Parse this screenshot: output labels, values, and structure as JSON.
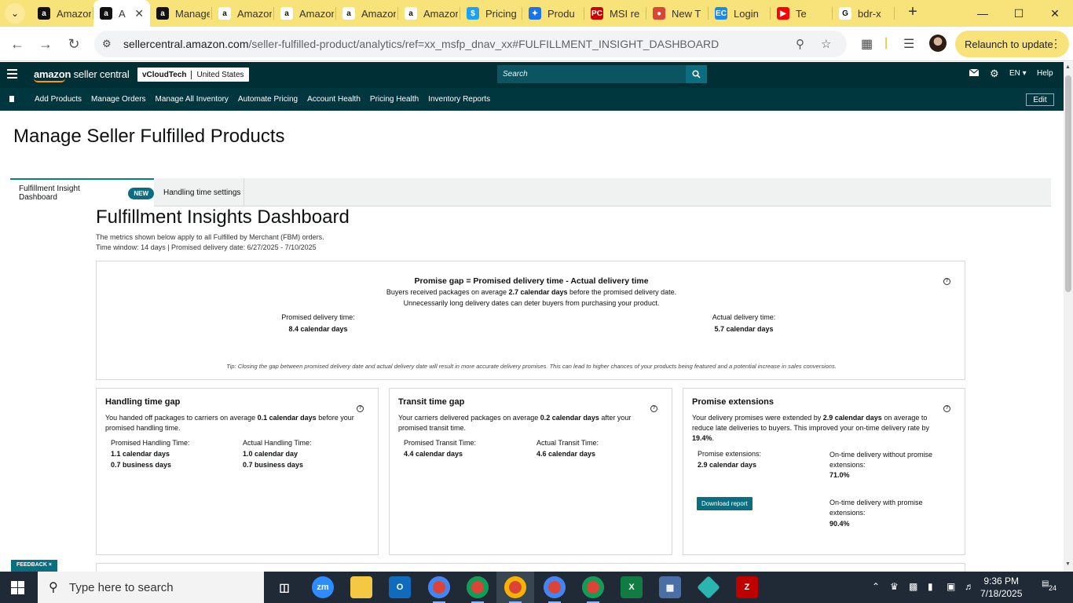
{
  "browser": {
    "tabs": [
      {
        "label": "Amazon",
        "favicon": "amazon-icon"
      },
      {
        "label": "A",
        "favicon": "amazon-icon",
        "active": true
      },
      {
        "label": "Manage",
        "favicon": "amazon-icon"
      },
      {
        "label": "Amazon",
        "favicon": "amazon-smile-icon"
      },
      {
        "label": "Amazon",
        "favicon": "amazon-smile-icon"
      },
      {
        "label": "Amazon",
        "favicon": "amazon-smile-icon"
      },
      {
        "label": "Amazon",
        "favicon": "amazon-smile-icon"
      },
      {
        "label": "Pricing",
        "favicon": "dollar-icon"
      },
      {
        "label": "Produ",
        "favicon": "globe-icon"
      },
      {
        "label": "MSI re",
        "favicon": "pc-icon"
      },
      {
        "label": "New T",
        "favicon": "chrome-icon"
      },
      {
        "label": "Login",
        "favicon": "ec-icon"
      },
      {
        "label": "Te",
        "favicon": "youtube-icon"
      },
      {
        "label": "bdr-x",
        "favicon": "google-icon"
      }
    ],
    "url_host": "sellercentral.amazon.com",
    "url_path": "/seller-fulfilled-product/analytics/ref=xx_msfp_dnav_xx#FULFILLMENT_INSIGHT_DASHBOARD",
    "relaunch_label": "Relaunch to update",
    "colors": {
      "tabstrip": "#f8e27a",
      "header": "#002f36",
      "accent": "#0b6e80"
    }
  },
  "seller_header": {
    "logo_text_1": "amazon",
    "logo_text_2": " seller central",
    "account_name": "vCloudTech",
    "account_region": "United States",
    "search_placeholder": "Search",
    "language": "EN",
    "help": "Help"
  },
  "nav": {
    "links": [
      "Add Products",
      "Manage Orders",
      "Manage All Inventory",
      "Automate Pricing",
      "Account Health",
      "Pricing Health",
      "Inventory Reports"
    ],
    "edit": "Edit"
  },
  "page": {
    "title": "Manage Seller Fulfilled Products",
    "tabs": {
      "insight": "Fulfillment Insight Dashboard",
      "new_badge": "NEW",
      "handling": "Handling time settings"
    },
    "dash_title": "Fulfillment Insights Dashboard",
    "dash_sub1": "The metrics shown below apply to all Fulfilled by Merchant (FBM) orders.",
    "dash_sub2": "Time window: 14 days | Promised delivery date: 6/27/2025 - 7/10/2025"
  },
  "promise_gap": {
    "title": "Promise gap = Promised delivery time - Actual delivery time",
    "line1_pre": "Buyers received packages on average ",
    "line1_bold": "2.7 calendar days",
    "line1_post": " before the promised delivery date.",
    "line2": "Unnecessarily long delivery dates can deter buyers from purchasing your product.",
    "promised_label": "Promised delivery time:",
    "promised_value": "8.4 calendar days",
    "actual_label": "Actual delivery time:",
    "actual_value": "5.7 calendar days",
    "tip": "Tip: Closing the gap between promised delivery date and actual delivery date will result in more accurate delivery promises. This can lead to higher chances of your products being featured and a potential increase in sales conversions."
  },
  "handling_gap": {
    "title": "Handling time gap",
    "desc_pre": "You handed off packages to carriers on average ",
    "desc_bold": "0.1 calendar days",
    "desc_post": " before your promised handling time.",
    "promised_label": "Promised Handling Time:",
    "promised_cal": "1.1 calendar days",
    "promised_bus": "0.7 business days",
    "actual_label": "Actual Handling Time:",
    "actual_cal": "1.0 calendar day",
    "actual_bus": "0.7 business days"
  },
  "transit_gap": {
    "title": "Transit time gap",
    "desc_pre": "Your carriers delivered packages on average ",
    "desc_bold": "0.2 calendar days",
    "desc_post": " after your promised transit time.",
    "promised_label": "Promised Transit Time:",
    "promised_cal": "4.4 calendar days",
    "actual_label": "Actual Transit Time:",
    "actual_cal": "4.6 calendar days"
  },
  "promise_ext": {
    "title": "Promise extensions",
    "desc_pre": "Your delivery promises were extended by ",
    "desc_bold1": "2.9 calendar days",
    "desc_mid": " on average to reduce late deliveries to buyers. This improved your on-time delivery rate by ",
    "desc_bold2": "19.4%",
    "desc_post": ".",
    "ext_label": "Promise extensions:",
    "ext_value": "2.9 calendar days",
    "without_label": "On-time delivery without promise extensions:",
    "without_value": "71.0%",
    "with_label": "On-time delivery with promise extensions:",
    "with_value": "90.4%",
    "download": "Download report"
  },
  "feedback": "FEEDBACK",
  "taskbar": {
    "search_placeholder": "Type here to search",
    "time": "9:36 PM",
    "date": "7/18/2025",
    "notifications": "24"
  }
}
